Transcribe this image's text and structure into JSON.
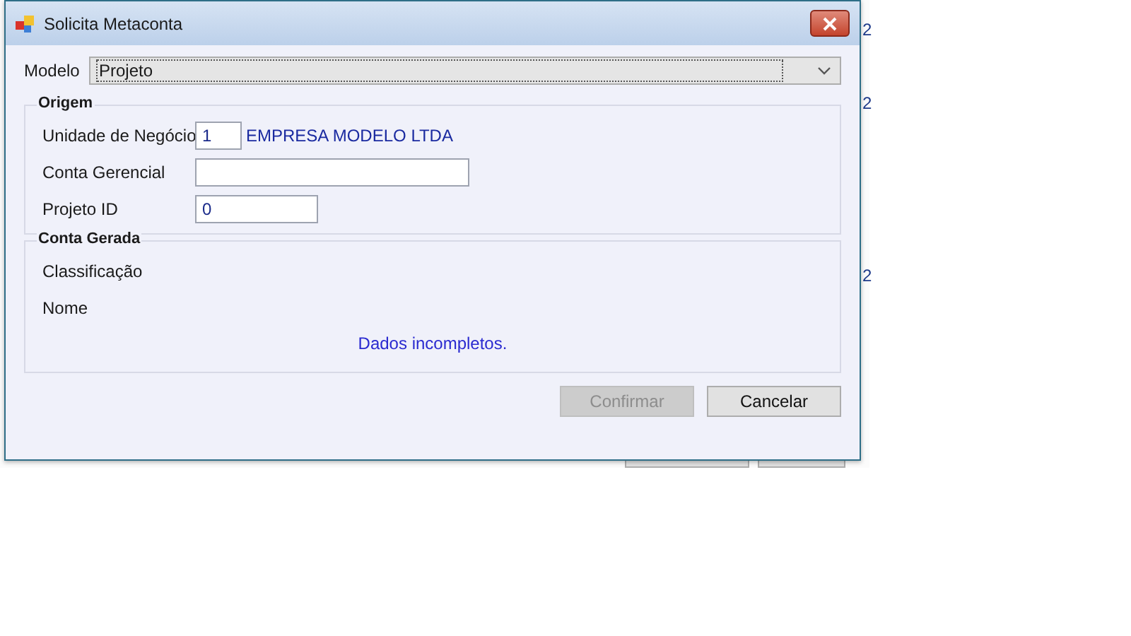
{
  "background_window": {
    "edge_texts": [
      "2",
      "2",
      "2"
    ],
    "buttons": [
      {
        "kind": "covered"
      },
      {
        "kind": "covered"
      }
    ]
  },
  "dialog": {
    "title": "Solicita Metaconta",
    "model": {
      "label": "Modelo",
      "value": "Projeto"
    },
    "groups": [
      {
        "title": "Origem",
        "rows": [
          {
            "kind": "short_field",
            "label": "Unidade de Negócio",
            "value": "1",
            "description": "EMPRESA MODELO LTDA"
          },
          {
            "kind": "wide_field",
            "label": "Conta Gerencial"
          },
          {
            "kind": "medium_field",
            "label": "Projeto ID",
            "value": "0"
          }
        ]
      },
      {
        "title": "Conta Gerada",
        "rows": [
          {
            "kind": "text",
            "label": "Classificação"
          },
          {
            "kind": "text",
            "label": "Nome"
          }
        ],
        "message": "Dados incompletos."
      }
    ],
    "buttons": [
      {
        "label": "Confirmar",
        "disabled": true
      },
      {
        "label": "Cancelar",
        "disabled": false
      }
    ]
  }
}
